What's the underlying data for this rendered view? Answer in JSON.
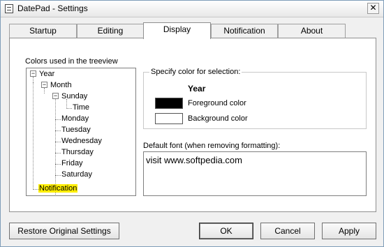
{
  "window": {
    "title": "DatePad - Settings",
    "close_glyph": "✕"
  },
  "tabs": [
    {
      "label": "Startup",
      "active": false
    },
    {
      "label": "Editing",
      "active": false
    },
    {
      "label": "Display",
      "active": true
    },
    {
      "label": "Notification",
      "active": false
    },
    {
      "label": "About",
      "active": false
    }
  ],
  "display": {
    "tree_section_label": "Colors used in the treeview",
    "tree": {
      "year": "Year",
      "month": "Month",
      "sunday": "Sunday",
      "time": "Time",
      "monday": "Monday",
      "tuesday": "Tuesday",
      "wednesday": "Wednesday",
      "thursday": "Thursday",
      "friday": "Friday",
      "saturday": "Saturday",
      "notification": "Notification",
      "collapse_glyph": "−"
    },
    "selection_group": {
      "legend": "Specify color for selection:",
      "selected_item": "Year",
      "foreground_label": "Foreground color",
      "foreground_color": "#000000",
      "background_label": "Background color",
      "background_color": "#ffffff"
    },
    "default_font_label": "Default font (when removing formatting):",
    "default_font_sample": "visit www.softpedia.com",
    "highlight_color": "#ffee00"
  },
  "buttons": {
    "restore": "Restore Original Settings",
    "ok": "OK",
    "cancel": "Cancel",
    "apply": "Apply"
  }
}
